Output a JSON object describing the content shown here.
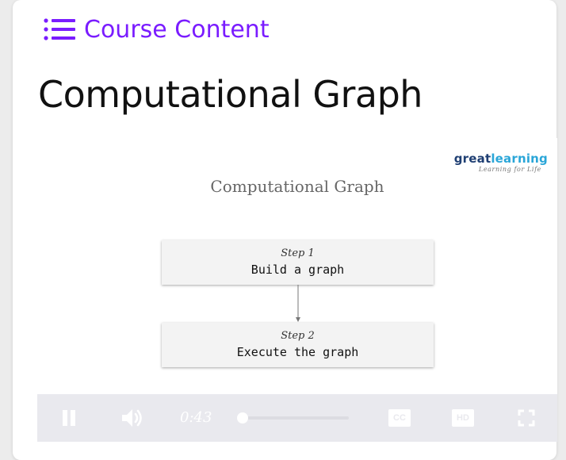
{
  "header": {
    "course_content_label": "Course Content",
    "course_content_icon": "list-icon",
    "accent_color": "#7a1cff"
  },
  "page": {
    "title": "Computational Graph"
  },
  "video": {
    "slide": {
      "brand_name_part1": "great",
      "brand_name_part2": "learning",
      "brand_tagline": "Learning for Life",
      "title": "Computational Graph",
      "steps": [
        {
          "label": "Step 1",
          "text": "Build a graph"
        },
        {
          "label": "Step 2",
          "text": "Execute the graph"
        }
      ]
    },
    "controls": {
      "play_state": "playing",
      "pause_icon": "pause-icon",
      "volume_icon": "volume-icon",
      "time": "0:43",
      "progress_fraction": 0.02,
      "cc_label": "CC",
      "hd_label": "HD",
      "fullscreen_icon": "fullscreen-icon"
    }
  }
}
